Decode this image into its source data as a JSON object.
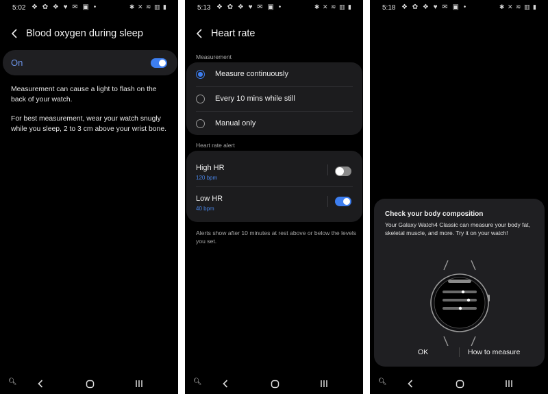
{
  "screens": [
    {
      "status": {
        "time": "5:02",
        "notif_icons": "❖ ✿ ❖ ♥ ✉ ▣ •",
        "system_icons": "✱ ✕ ≋ ▥ ▮"
      },
      "header": {
        "title": "Blood oxygen during sleep"
      },
      "toggle_row": {
        "label": "On",
        "state": "on"
      },
      "paragraphs": [
        "Measurement can cause a light to flash on the back of your watch.",
        "For best measurement, wear your watch snugly while you sleep, 2 to 3 cm above your wrist bone."
      ]
    },
    {
      "status": {
        "time": "5:13",
        "notif_icons": "❖ ✿ ❖ ♥ ✉ ▣ •",
        "system_icons": "✱ ✕ ≋ ▥ ▮"
      },
      "header": {
        "title": "Heart rate"
      },
      "measurement": {
        "label": "Measurement",
        "options": [
          "Measure continuously",
          "Every 10 mins while still",
          "Manual only"
        ],
        "selected": "Measure continuously"
      },
      "alert": {
        "label": "Heart rate alert",
        "items": [
          {
            "title": "High HR",
            "value": "120 bpm",
            "state": "off"
          },
          {
            "title": "Low HR",
            "value": "40 bpm",
            "state": "on"
          }
        ]
      },
      "footnote": "Alerts show after 10 minutes at rest above or below the levels you set."
    },
    {
      "status": {
        "time": "5:18",
        "notif_icons": "❖ ✿ ❖ ♥ ✉ ▣ •",
        "system_icons": "✱ ✕ ≋ ▥ ▮"
      },
      "dialog": {
        "title": "Check your body composition",
        "body": "Your Galaxy Watch4 Classic can measure your body fat, skeletal muscle, and more. Try it on your watch!",
        "ok_label": "OK",
        "how_label": "How to measure"
      }
    }
  ],
  "nav": {
    "zoom_icon": "zoom-icon",
    "back_icon": "back-icon",
    "home_icon": "home-icon",
    "recents_icon": "recents-icon"
  },
  "colors": {
    "accent": "#3d7ef0",
    "link": "#6d95ea",
    "card": "#1f1f22",
    "background": "#000000"
  }
}
